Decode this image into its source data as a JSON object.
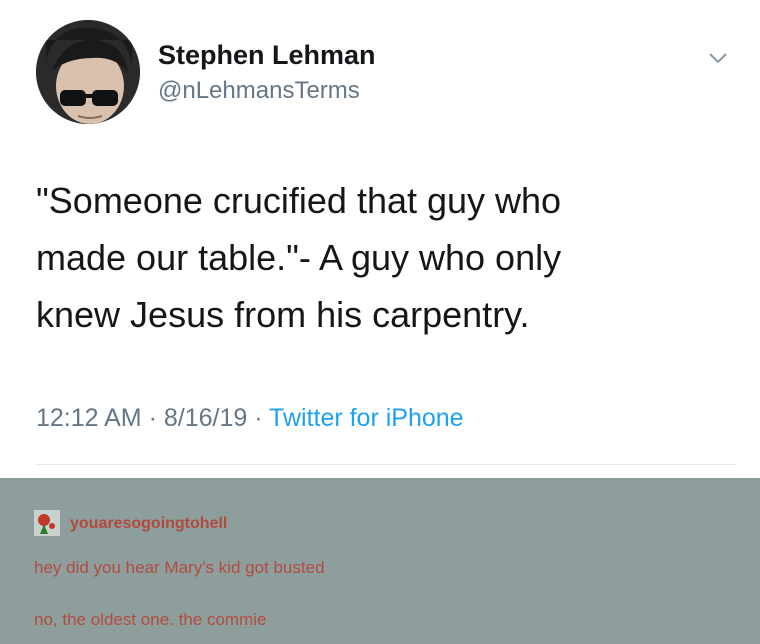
{
  "tweet": {
    "author_name": "Stephen Lehman",
    "author_handle": "@nLehmansTerms",
    "text": "\"Someone crucified that guy who\nmade our table.\"- A guy who only\nknew Jesus from his carpentry.",
    "time": "12:12 AM",
    "separator": " · ",
    "date": "8/16/19",
    "source": "Twitter for iPhone",
    "menu_icon": "chevron-down-icon"
  },
  "tumblr": {
    "username": "youaresogoingtohell",
    "lines": [
      "hey did you hear Mary's kid got busted",
      "no, the oldest one. the commie"
    ]
  },
  "colors": {
    "name": "#14171a",
    "secondary": "#657786",
    "link": "#1da1f2",
    "tumblr_bg": "#8e9e9c",
    "tumblr_text": "#b24c42"
  }
}
